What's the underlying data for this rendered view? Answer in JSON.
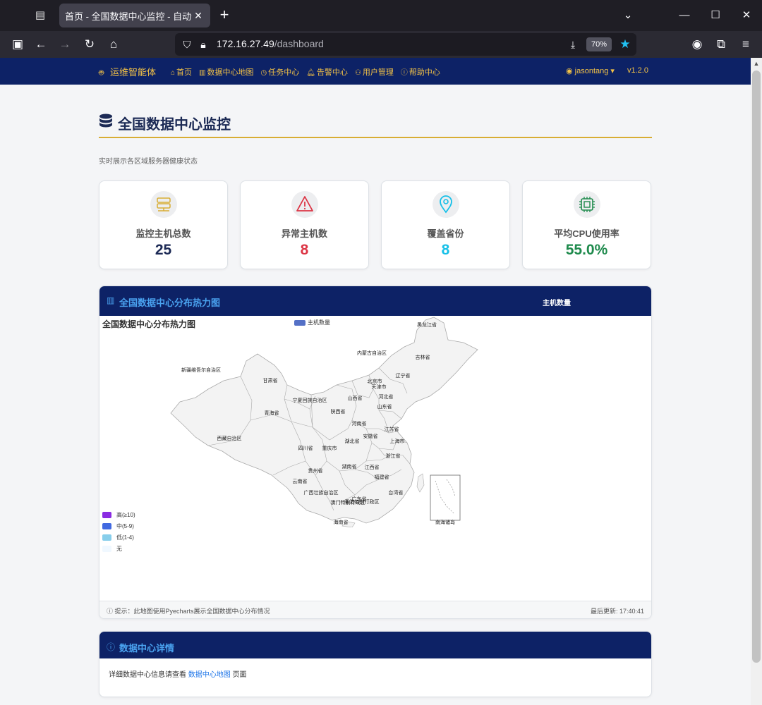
{
  "browser": {
    "tab_title": "首页 - 全国数据中心监控 - 自动化运",
    "url_host": "172.16.27.49",
    "url_path": "/dashboard",
    "zoom": "70%"
  },
  "app": {
    "brand": "运维智能体",
    "nav": [
      {
        "label": "首页",
        "icon": "home-icon"
      },
      {
        "label": "数据中心地图",
        "icon": "map-icon"
      },
      {
        "label": "任务中心",
        "icon": "clock-icon"
      },
      {
        "label": "告警中心",
        "icon": "bell-icon"
      },
      {
        "label": "用户管理",
        "icon": "users-icon"
      },
      {
        "label": "帮助中心",
        "icon": "help-icon"
      }
    ],
    "user": "jasontang",
    "version": "v1.2.0"
  },
  "page": {
    "title": "全国数据中心监控",
    "subtitle": "实时展示各区域服务器健康状态"
  },
  "stats": [
    {
      "label": "监控主机总数",
      "value": "25",
      "color": "#1c2a55",
      "icon": "server-icon"
    },
    {
      "label": "异常主机数",
      "value": "8",
      "color": "#dc3545",
      "icon": "warning-icon"
    },
    {
      "label": "覆盖省份",
      "value": "8",
      "color": "#17c0e8",
      "icon": "location-pin-icon"
    },
    {
      "label": "平均CPU使用率",
      "value": "55.0%",
      "color": "#1e8a4c",
      "icon": "cpu-icon"
    }
  ],
  "map_panel": {
    "title": "全国数据中心分布热力图",
    "header_right": "主机数量",
    "chart_title": "全国数据中心分布热力图",
    "legend_series": "主机数量",
    "visual_map": [
      {
        "label": "高(≥10)",
        "color": "#8a2be2"
      },
      {
        "label": "中(5-9)",
        "color": "#4169e1"
      },
      {
        "label": "低(1-4)",
        "color": "#87ceeb"
      },
      {
        "label": "无",
        "color": "#f0f8ff"
      }
    ],
    "provinces": [
      {
        "name": "黑龙江省"
      },
      {
        "name": "吉林省"
      },
      {
        "name": "辽宁省"
      },
      {
        "name": "内蒙古自治区"
      },
      {
        "name": "新疆维吾尔自治区"
      },
      {
        "name": "甘肃省"
      },
      {
        "name": "北京市"
      },
      {
        "name": "天津市"
      },
      {
        "name": "河北省"
      },
      {
        "name": "宁夏回族自治区"
      },
      {
        "name": "山西省"
      },
      {
        "name": "山东省"
      },
      {
        "name": "青海省"
      },
      {
        "name": "陕西省"
      },
      {
        "name": "河南省"
      },
      {
        "name": "江苏省"
      },
      {
        "name": "西藏自治区"
      },
      {
        "name": "安徽省"
      },
      {
        "name": "上海市"
      },
      {
        "name": "四川省"
      },
      {
        "name": "重庆市"
      },
      {
        "name": "湖北省"
      },
      {
        "name": "浙江省"
      },
      {
        "name": "贵州省"
      },
      {
        "name": "湖南省"
      },
      {
        "name": "江西省"
      },
      {
        "name": "福建省"
      },
      {
        "name": "云南省"
      },
      {
        "name": "广西壮族自治区"
      },
      {
        "name": "广东省"
      },
      {
        "name": "台湾省"
      },
      {
        "name": "香港特别行政区"
      },
      {
        "name": "澳门特别行政区"
      },
      {
        "name": "海南省"
      },
      {
        "name": "南海诸岛"
      }
    ],
    "footer_note": "提示：此地图使用Pyecharts展示全国数据中心分布情况",
    "last_update": "最后更新: 17:40:41"
  },
  "detail_panel": {
    "title": "数据中心详情",
    "text_before": "详细数据中心信息请查看",
    "link": "数据中心地图",
    "text_after": "页面"
  }
}
